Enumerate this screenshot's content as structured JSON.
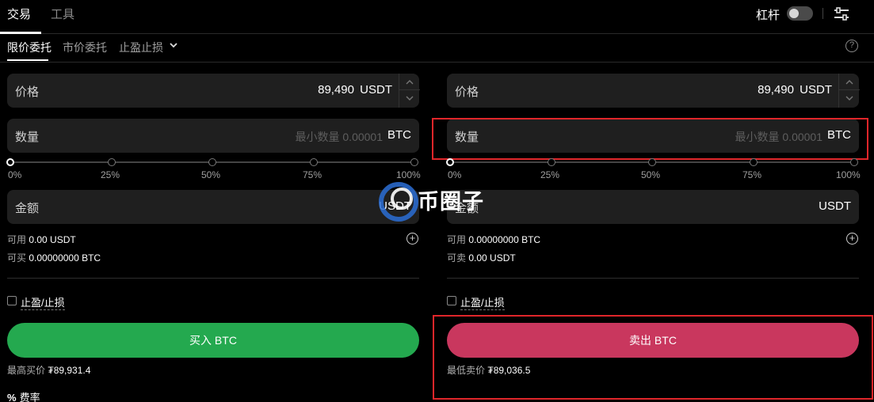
{
  "top": {
    "tabs": [
      {
        "label": "交易"
      },
      {
        "label": "工具"
      }
    ],
    "leverage_label": "杠杆"
  },
  "subtabs": [
    {
      "label": "限价委托"
    },
    {
      "label": "市价委托"
    },
    {
      "label": "止盈止损"
    }
  ],
  "help_glyph": "?",
  "buy": {
    "price_label": "价格",
    "price_value": "89,490",
    "price_unit": "USDT",
    "qty_label": "数量",
    "qty_placeholder": "最小数量 0.00001",
    "qty_unit": "BTC",
    "slider_marks": [
      "0%",
      "25%",
      "50%",
      "75%",
      "100%"
    ],
    "amount_label": "金额",
    "amount_unit": "USDT",
    "available_label": "可用",
    "available_value": "0.00 USDT",
    "can_label": "可买",
    "can_value": "0.00000000 BTC",
    "tpsl_label": "止盈/止损",
    "button_label": "买入 BTC",
    "best_label": "最高买价",
    "best_value": "₮89,931.4"
  },
  "sell": {
    "price_label": "价格",
    "price_value": "89,490",
    "price_unit": "USDT",
    "qty_label": "数量",
    "qty_placeholder": "最小数量 0.00001",
    "qty_unit": "BTC",
    "slider_marks": [
      "0%",
      "25%",
      "50%",
      "75%",
      "100%"
    ],
    "amount_label": "金额",
    "amount_unit": "USDT",
    "available_label": "可用",
    "available_value": "0.00000000 BTC",
    "can_label": "可卖",
    "can_value": "0.00 USDT",
    "tpsl_label": "止盈/止损",
    "button_label": "卖出 BTC",
    "best_label": "最低卖价",
    "best_value": "₮89,036.5"
  },
  "fee_label": "费率",
  "fee_icon": "%",
  "watermark": "币圈子",
  "colors": {
    "buy": "#24a94f",
    "sell": "#c9375e",
    "highlight": "#e0262a"
  }
}
